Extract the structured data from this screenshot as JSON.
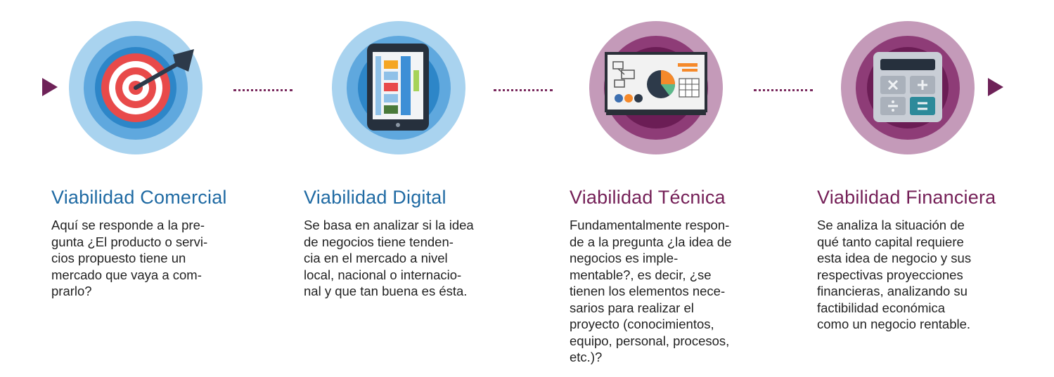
{
  "colors": {
    "blue_title": "#1f6aa3",
    "purple_title": "#741f57",
    "arrow": "#6e2258",
    "blue_ring_outer": "#a9d3ef",
    "blue_ring_mid": "#5fa8de",
    "blue_ring_inner": "#2d86c8",
    "purple_ring_outer": "#c49ab9",
    "purple_ring_mid": "#8e3c77",
    "purple_ring_inner": "#6b1d55"
  },
  "steps": [
    {
      "icon": "target-icon",
      "title": "Viabilidad Comercial",
      "description": "Aquí se responde a la pre-\ngunta ¿El producto o servi-\ncios propuesto tiene un\nmercado que vaya a com-\nprarlo?"
    },
    {
      "icon": "tablet-icon",
      "title": "Viabilidad Digital",
      "description": "Se basa en analizar si la idea\nde negocios tiene tenden-\ncia en el mercado a nivel\nlocal, nacional o internacio-\nnal y que tan buena es ésta."
    },
    {
      "icon": "presentation-board-icon",
      "title": "Viabilidad Técnica",
      "description": "Fundamentalmente respon-\nde a la pregunta ¿la idea de\nnegocios es imple-\nmentable?, es decir, ¿se\ntienen los elementos nece-\nsarios para realizar el\nproyecto (conocimientos,\nequipo, personal, procesos,\netc.)?"
    },
    {
      "icon": "calculator-icon",
      "title": "Viabilidad Financiera",
      "description": "Se analiza la situación de\nqué tanto capital requiere\nesta idea de negocio y sus\nrespectivas proyecciones\nfinancieras, analizando su\nfactibilidad económica\ncomo un negocio rentable."
    }
  ]
}
